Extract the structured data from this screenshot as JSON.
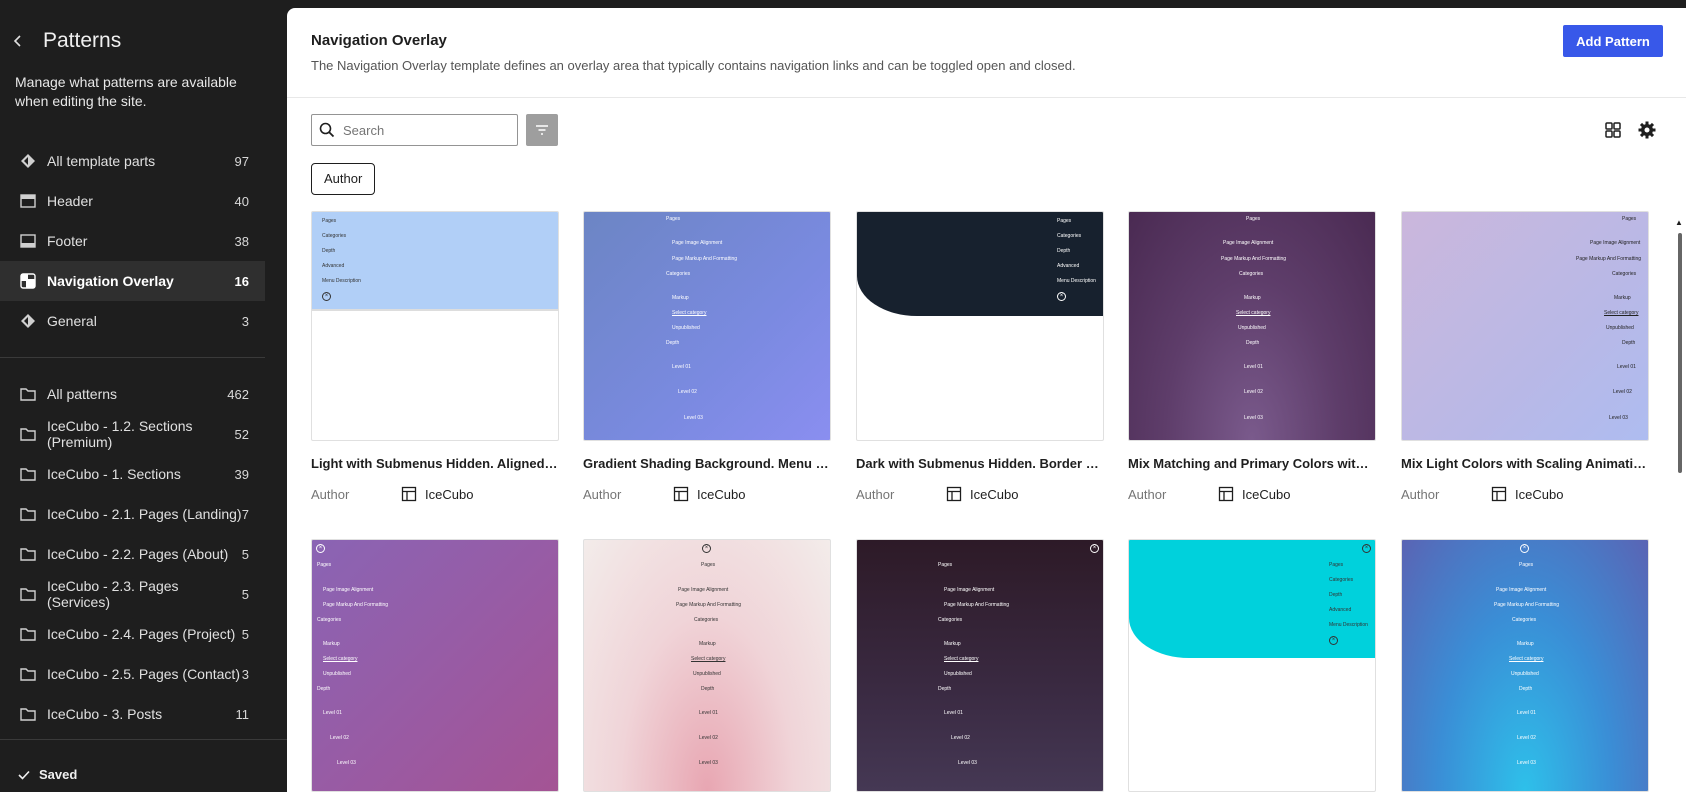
{
  "sidebar": {
    "title": "Patterns",
    "description": "Manage what patterns are available when editing the site.",
    "template_parts": [
      {
        "label": "All template parts",
        "count": "97"
      },
      {
        "label": "Header",
        "count": "40"
      },
      {
        "label": "Footer",
        "count": "38"
      },
      {
        "label": "Navigation Overlay",
        "count": "16"
      },
      {
        "label": "General",
        "count": "3"
      }
    ],
    "pattern_categories": [
      {
        "label": "All patterns",
        "count": "462"
      },
      {
        "label": "IceCubo - 1.2. Sections (Premium)",
        "count": "52"
      },
      {
        "label": "IceCubo - 1. Sections",
        "count": "39"
      },
      {
        "label": "IceCubo - 2.1. Pages (Landing)",
        "count": "7"
      },
      {
        "label": "IceCubo - 2.2. Pages (About)",
        "count": "5"
      },
      {
        "label": "IceCubo - 2.3. Pages (Services)",
        "count": "5"
      },
      {
        "label": "IceCubo - 2.4. Pages (Project)",
        "count": "5"
      },
      {
        "label": "IceCubo - 2.5. Pages (Contact)",
        "count": "3"
      },
      {
        "label": "IceCubo - 3. Posts",
        "count": "11"
      }
    ],
    "saved_label": "Saved"
  },
  "main": {
    "title": "Navigation Overlay",
    "description": "The Navigation Overlay template defines an overlay area that typically contains navigation links and can be toggled open and closed.",
    "add_button": "Add Pattern",
    "search_placeholder": "Search",
    "filter_chip": "Author"
  },
  "preview_text": {
    "pages": "Pages",
    "categories": "Categories",
    "depth": "Depth",
    "advanced": "Advanced",
    "menu_description": "Menu Description",
    "page_image_alignment": "Page Image Alignment",
    "page_markup": "Page Markup And Formatting",
    "markup": "Markup",
    "select_category": "Select category",
    "unpublished": "Unpublished",
    "level01": "Level 01",
    "level02": "Level 02",
    "level03": "Level 03"
  },
  "cards": [
    {
      "title": "Light with Submenus Hidden. Aligned …",
      "author_label": "Author",
      "author": "IceCubo"
    },
    {
      "title": "Gradient Shading Background. Menu L…",
      "author_label": "Author",
      "author": "IceCubo"
    },
    {
      "title": "Dark with Submenus Hidden. Border o…",
      "author_label": "Author",
      "author": "IceCubo"
    },
    {
      "title": "Mix Matching and Primary Colors with …",
      "author_label": "Author",
      "author": "IceCubo"
    },
    {
      "title": "Mix Light Colors with Scaling Animatio…",
      "author_label": "Author",
      "author": "IceCubo"
    }
  ],
  "colors": {
    "accent": "#3858e9",
    "sidebar_bg": "#1e1e1e",
    "active_item_bg": "#2f2f2f"
  }
}
